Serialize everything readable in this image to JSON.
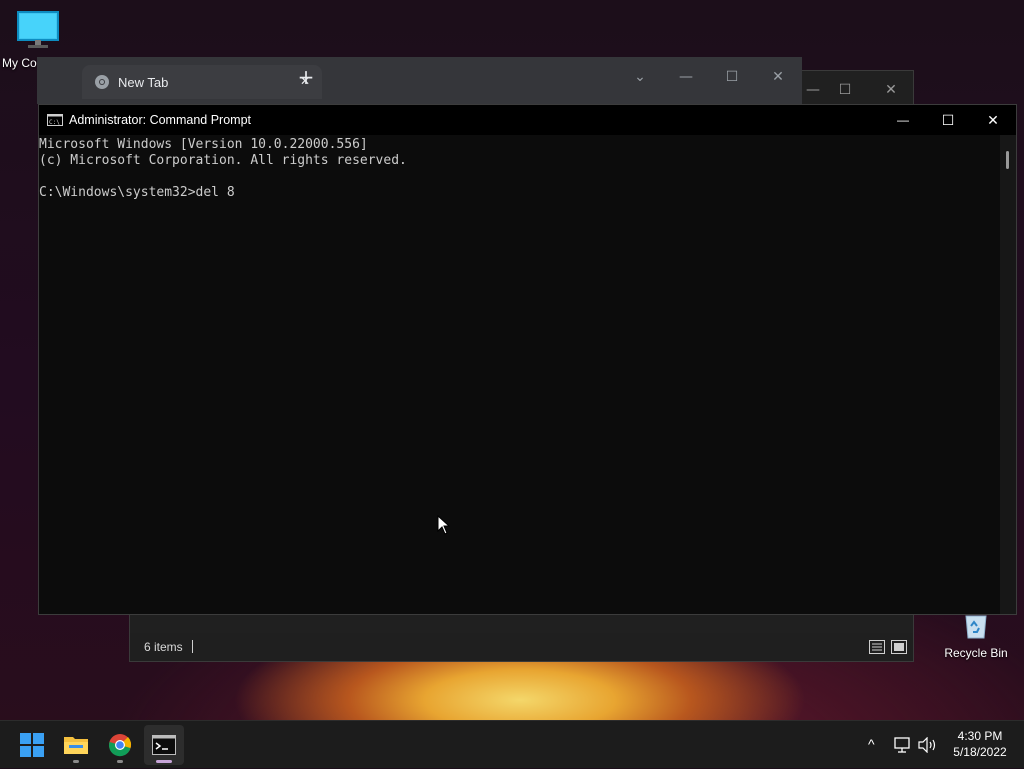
{
  "desktop": {
    "icons": [
      {
        "label": "My Co",
        "icon": "monitor-icon"
      },
      {
        "label": "Recycle Bin",
        "icon": "recycle-bin-icon"
      }
    ]
  },
  "browser": {
    "tab_title": "New Tab",
    "tab_icon": "chrome-icon",
    "new_tab_symbol": "+",
    "close_symbol": "✕",
    "dropdown_symbol": "⌄",
    "minimize_symbol": "—",
    "maximize_symbol": "☐"
  },
  "explorer": {
    "status_text": "6 items",
    "view_details_icon": "details-view-icon",
    "view_tiles_icon": "large-icons-view-icon"
  },
  "cmd": {
    "title": "Administrator: Command Prompt",
    "minimize_symbol": "—",
    "maximize_symbol": "☐",
    "close_symbol": "✕",
    "lines": [
      "Microsoft Windows [Version 10.0.22000.556]",
      "(c) Microsoft Corporation. All rights reserved.",
      "",
      "C:\\Windows\\system32>del 8"
    ]
  },
  "taskbar": {
    "apps": [
      {
        "name": "start",
        "icon": "windows-start-icon"
      },
      {
        "name": "file-explorer",
        "icon": "folder-icon"
      },
      {
        "name": "chrome",
        "icon": "chrome-icon"
      },
      {
        "name": "command-prompt",
        "icon": "terminal-icon"
      }
    ],
    "tray": {
      "chevron": "^",
      "time": "4:30 PM",
      "date": "5/18/2022"
    }
  }
}
